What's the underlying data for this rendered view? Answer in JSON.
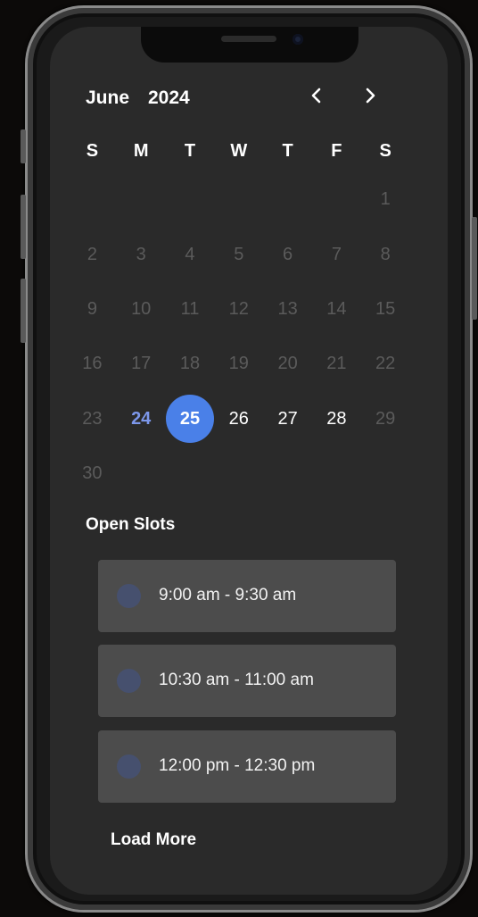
{
  "calendar": {
    "month": "June",
    "year": "2024",
    "prev_icon": "chevron-left-icon",
    "next_icon": "chevron-right-icon",
    "weekdays": [
      "S",
      "M",
      "T",
      "W",
      "T",
      "F",
      "S"
    ],
    "days": [
      {
        "label": "",
        "state": "empty"
      },
      {
        "label": "",
        "state": "empty"
      },
      {
        "label": "",
        "state": "empty"
      },
      {
        "label": "",
        "state": "empty"
      },
      {
        "label": "",
        "state": "empty"
      },
      {
        "label": "",
        "state": "empty"
      },
      {
        "label": "1",
        "state": "disabled"
      },
      {
        "label": "2",
        "state": "disabled"
      },
      {
        "label": "3",
        "state": "disabled"
      },
      {
        "label": "4",
        "state": "disabled"
      },
      {
        "label": "5",
        "state": "disabled"
      },
      {
        "label": "6",
        "state": "disabled"
      },
      {
        "label": "7",
        "state": "disabled"
      },
      {
        "label": "8",
        "state": "disabled"
      },
      {
        "label": "9",
        "state": "disabled"
      },
      {
        "label": "10",
        "state": "disabled"
      },
      {
        "label": "11",
        "state": "disabled"
      },
      {
        "label": "12",
        "state": "disabled"
      },
      {
        "label": "13",
        "state": "disabled"
      },
      {
        "label": "14",
        "state": "disabled"
      },
      {
        "label": "15",
        "state": "disabled"
      },
      {
        "label": "16",
        "state": "disabled"
      },
      {
        "label": "17",
        "state": "disabled"
      },
      {
        "label": "18",
        "state": "disabled"
      },
      {
        "label": "19",
        "state": "disabled"
      },
      {
        "label": "20",
        "state": "disabled"
      },
      {
        "label": "21",
        "state": "disabled"
      },
      {
        "label": "22",
        "state": "disabled"
      },
      {
        "label": "23",
        "state": "disabled"
      },
      {
        "label": "24",
        "state": "today"
      },
      {
        "label": "25",
        "state": "selected"
      },
      {
        "label": "26",
        "state": "available"
      },
      {
        "label": "27",
        "state": "available"
      },
      {
        "label": "28",
        "state": "available"
      },
      {
        "label": "29",
        "state": "disabled"
      },
      {
        "label": "30",
        "state": "disabled"
      }
    ]
  },
  "slots": {
    "heading": "Open Slots",
    "items": [
      {
        "time": "9:00 am - 9:30 am"
      },
      {
        "time": "10:30 am - 11:00 am"
      },
      {
        "time": "12:00 pm - 12:30 pm"
      }
    ],
    "load_more": "Load More"
  },
  "colors": {
    "accent": "#4a80e8",
    "today": "#7c97ea",
    "screen_bg": "#2a2a2a",
    "slot_bg": "#4c4c4c",
    "radio": "#46506e"
  }
}
